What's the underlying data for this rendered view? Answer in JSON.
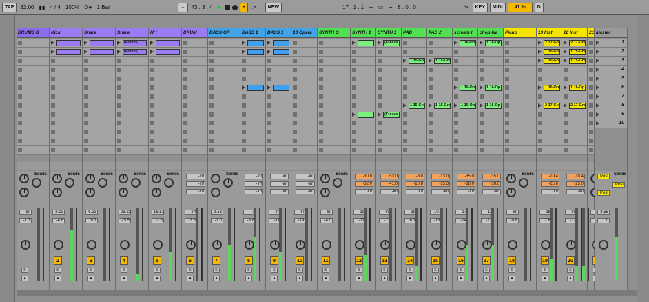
{
  "transport": {
    "tap": "TAP",
    "tempo": "82.00",
    "timesig": "4 / 4",
    "zoom": "100%",
    "quantize": "1 Bar",
    "position": "43 . 3 . 4",
    "new_label": "NEW",
    "loop_start": "17 . 1 . 1",
    "loop_length": "8 . 0 . 0",
    "key": "KEY",
    "midi": "MIDI",
    "cpu": "41 %",
    "disk": "D"
  },
  "colors": {
    "drums": "#8b6cf0",
    "bass": "#43a3e8",
    "synth": "#52e052",
    "clip_blue": "#3ea0ef",
    "clip_purple": "#9c7cf4",
    "clip_green": "#7cf07c",
    "yellow": "#f5e400",
    "orange": "#ff9a3c"
  },
  "tracks": [
    {
      "name": "DRUMS G",
      "num": "",
      "color": "#8b6cf0",
      "vol": "-Inf",
      "peak": "-1.7",
      "meter": 0,
      "sendA": "",
      "sendB": "",
      "sendC": ""
    },
    {
      "name": "Kick",
      "num": "2",
      "color": "#9c7cf4",
      "vol": "-8.93",
      "peak": "-4.6",
      "meter": 0.7,
      "sendA": "",
      "sendB": "",
      "sendC": ""
    },
    {
      "name": "Snare",
      "num": "3",
      "color": "#9c7cf4",
      "vol": "-6.23",
      "peak": "-5.7",
      "meter": 0,
      "sendA": "",
      "sendB": "",
      "sendC": ""
    },
    {
      "name": "Snare",
      "num": "4",
      "color": "#9c7cf4",
      "vol": "-23.22",
      "peak": "-25.5",
      "meter": 0.1,
      "sendA": "",
      "sendB": "",
      "sendC": ""
    },
    {
      "name": "HH",
      "num": "5",
      "color": "#9c7cf4",
      "vol": "-16.51",
      "peak": "-2.8",
      "meter": 0.4,
      "sendA": "",
      "sendB": "",
      "sendC": ""
    },
    {
      "name": "DRUM",
      "num": "6",
      "color": "#9c7cf4",
      "vol": "-Inf",
      "peak": "-3.6",
      "meter": 0,
      "sendA": "-inf",
      "sendB": "-inf",
      "sendC": "-inf"
    },
    {
      "name": "BASS GR",
      "num": "7",
      "color": "#43a3e8",
      "vol": "-9.13",
      "peak": "-2.0",
      "meter": 0.5,
      "sendA": "",
      "sendB": "",
      "sendC": ""
    },
    {
      "name": "BASS 1",
      "num": "8",
      "color": "#43a3e8",
      "vol": "-7",
      "peak": "-8.8",
      "meter": 0.6,
      "sendA": "-inf",
      "sendB": "-inf",
      "sendC": "-inf"
    },
    {
      "name": "BASS 1",
      "num": "9",
      "color": "#43a3e8",
      "vol": "-Inf",
      "peak": "-11",
      "meter": 0.4,
      "sendA": "-inf",
      "sendB": "-inf",
      "sendC": "-inf"
    },
    {
      "name": "10 Opera",
      "num": "10",
      "color": "#43a3e8",
      "vol": "-Inf",
      "peak": "-19.",
      "meter": 0,
      "sendA": "-inf",
      "sendB": "-inf",
      "sendC": "-inf"
    },
    {
      "name": "SYNTH G",
      "num": "11",
      "color": "#52e052",
      "vol": "-Inf",
      "peak": "-4.0",
      "meter": 0,
      "sendA": "",
      "sendB": "",
      "sendC": ""
    },
    {
      "name": "SYNTH 1",
      "num": "12",
      "color": "#52e052",
      "vol": "-19",
      "peak": "-17",
      "meter": 0.35,
      "sendA": "-30.0",
      "sendB": "-32.0",
      "sendC": "-inf"
    },
    {
      "name": "SYNTH 1",
      "num": "13",
      "color": "#52e052",
      "vol": "-Inf",
      "peak": "-17",
      "meter": 0,
      "sendA": "-53.0",
      "sendB": "-41.0",
      "sendC": "-inf"
    },
    {
      "name": "PAD",
      "num": "14",
      "color": "#52e052",
      "vol": "-39",
      "peak": "-6.7",
      "meter": 0.2,
      "sendA": "-8.0",
      "sendB": "-10.8",
      "sendC": "-inf"
    },
    {
      "name": "PAD 2",
      "num": "15",
      "color": "#52e052",
      "vol": "-107",
      "peak": "-13.",
      "meter": 0,
      "sendA": "-13.0",
      "sendB": "-15.3",
      "sendC": "-inf"
    },
    {
      "name": "scream l",
      "num": "16",
      "color": "#52e052",
      "vol": "-17",
      "peak": "-14",
      "meter": 0.5,
      "sendA": "-35.0",
      "sendB": "-38.0",
      "sendC": "-inf"
    },
    {
      "name": "chop lea",
      "num": "17",
      "color": "#52e052",
      "vol": "-11",
      "peak": "-13",
      "meter": 0.5,
      "sendA": "-35.0",
      "sendB": "-38.0",
      "sendC": "-inf"
    },
    {
      "name": "Piano",
      "num": "18",
      "color": "#f5e400",
      "vol": "-Inf",
      "peak": "-0.8",
      "meter": 0,
      "sendA": "",
      "sendB": "",
      "sendC": ""
    },
    {
      "name": "19 Inst",
      "num": "19",
      "color": "#f5e400",
      "vol": "-16",
      "peak": "-7.6",
      "meter": 0.3,
      "sendA": "-19.4",
      "sendB": "-25.6",
      "sendC": "-inf"
    },
    {
      "name": "20 Inst",
      "num": "20",
      "color": "#f5e400",
      "vol": "-Inf",
      "peak": "-12",
      "meter": 0.2,
      "sendA": "-18.4",
      "sendB": "-25.0",
      "sendC": "-inf"
    },
    {
      "name": "21",
      "num": "2",
      "color": "#f5e400",
      "vol": "-Inf",
      "peak": "-",
      "meter": 0.2,
      "sendA": "",
      "sendB": "",
      "sendC": ""
    }
  ],
  "master": {
    "name": "Master",
    "vol": "-3.55",
    "peak": "0",
    "meter": 0.6,
    "scenes": [
      "1",
      "2",
      "3",
      "4",
      "5",
      "6",
      "7",
      "8",
      "9",
      "10"
    ],
    "post_labels": [
      "Post",
      "Post",
      "Post"
    ],
    "sends_label": "Sends"
  },
  "clips": {
    "Kick": [
      0,
      1
    ],
    "Snare_r1": [
      "(Freeze)",
      "(Freeze)"
    ],
    "HH": [
      0,
      1
    ],
    "BASS1": [
      0,
      1,
      5
    ],
    "SYNTH1": [
      0,
      8
    ],
    "SYNTH1b": [
      "(Freeze",
      "(Freeze"
    ],
    "PAD": [
      "1 15-Gre",
      "1 15-Gre"
    ],
    "PAD2": [
      "1 15-Gre",
      "1 15-Gre"
    ],
    "scream": [
      "1 16-Op",
      "1 16-Op",
      "1 16-Op"
    ],
    "chop": [
      "1 16-Op",
      "1 16-Op",
      "1 16-Op"
    ],
    "inst19": [
      "2 17-Gre",
      "1 15-Gre",
      "1 15-Gre",
      "1 16-Op",
      "2 17-Gre"
    ],
    "inst20": [
      "2 17-Gre",
      "1 15-Gre",
      "1 15-Gre",
      "1 16-Op",
      "2 17-Gre"
    ]
  }
}
